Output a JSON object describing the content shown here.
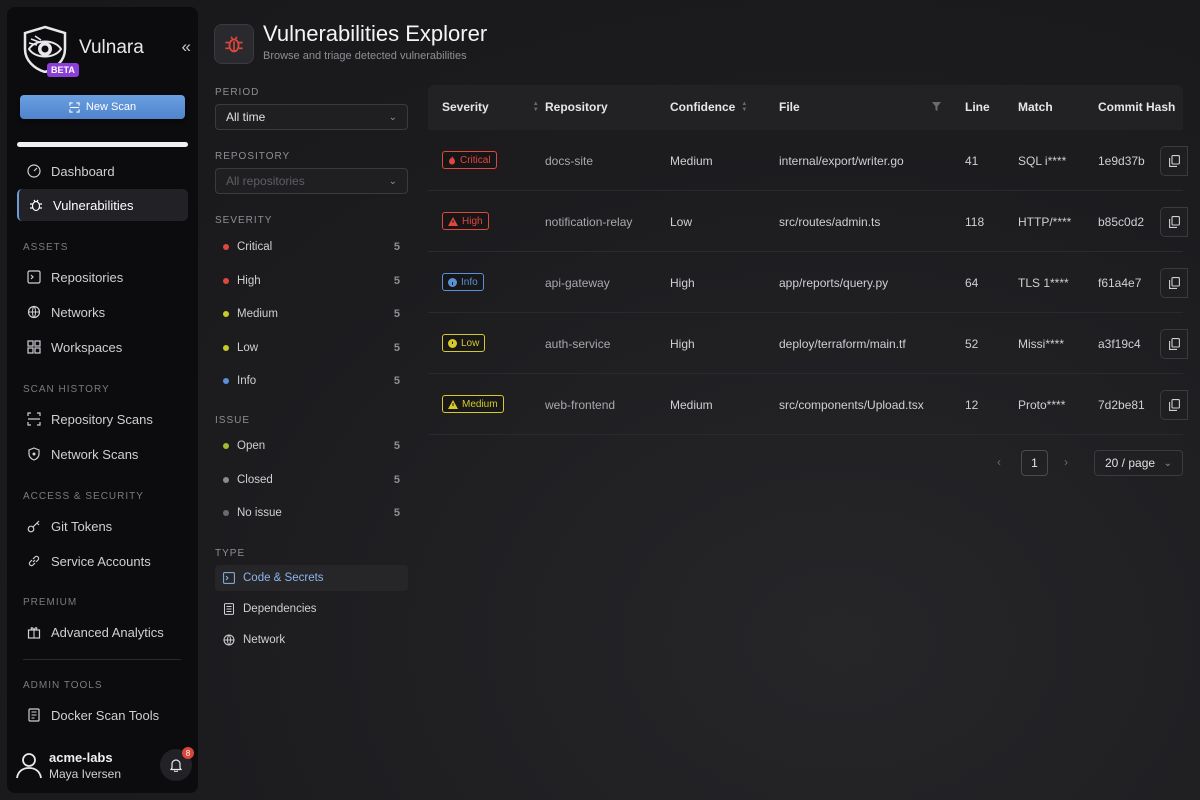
{
  "brand": {
    "name": "Vulnara",
    "badge": "BETA"
  },
  "sidebar": {
    "new_scan": "New Scan",
    "progress": 1.0,
    "items": {
      "dashboard": "Dashboard",
      "vulnerabilities": "Vulnerabilities",
      "repositories": "Repositories",
      "networks": "Networks",
      "workspaces": "Workspaces",
      "repository_scans": "Repository Scans",
      "network_scans": "Network Scans",
      "git_tokens": "Git Tokens",
      "service_accounts": "Service Accounts",
      "advanced_analytics": "Advanced Analytics",
      "docker_scan_tools": "Docker Scan Tools"
    },
    "sections": {
      "assets": "ASSETS",
      "scan_history": "SCAN HISTORY",
      "access_security": "ACCESS & SECURITY",
      "premium": "PREMIUM",
      "admin_tools": "ADMIN TOOLS"
    },
    "user": {
      "org": "acme-labs",
      "name": "Maya Iversen",
      "notifications": "8"
    }
  },
  "header": {
    "title": "Vulnerabilities Explorer",
    "subtitle": "Browse and triage detected vulnerabilities"
  },
  "filters": {
    "period_label": "PERIOD",
    "period_value": "All time",
    "repository_label": "REPOSITORY",
    "repository_placeholder": "All repositories",
    "severity_label": "SEVERITY",
    "severity": [
      {
        "label": "Critical",
        "count": "5",
        "color": "#e0473d"
      },
      {
        "label": "High",
        "count": "5",
        "color": "#e0473d"
      },
      {
        "label": "Medium",
        "count": "5",
        "color": "#c9c92a"
      },
      {
        "label": "Low",
        "count": "5",
        "color": "#c9c92a"
      },
      {
        "label": "Info",
        "count": "5",
        "color": "#5b8fd6"
      }
    ],
    "issue_label": "ISSUE",
    "issue": [
      {
        "label": "Open",
        "count": "5",
        "color": "#a7b82a"
      },
      {
        "label": "Closed",
        "count": "5",
        "color": "#8a8a90"
      },
      {
        "label": "No issue",
        "count": "5",
        "color": "#6a6a70"
      }
    ],
    "type_label": "TYPE",
    "types": [
      {
        "label": "Code & Secrets",
        "icon": "terminal-icon"
      },
      {
        "label": "Dependencies",
        "icon": "list-icon"
      },
      {
        "label": "Network",
        "icon": "globe-icon"
      }
    ]
  },
  "table": {
    "columns": [
      "Severity",
      "Repository",
      "Confidence",
      "File",
      "Line",
      "Match",
      "Commit Hash"
    ],
    "rows": [
      {
        "severity": "Critical",
        "sev_color": "#e0473d",
        "sev_icon": "fire-icon",
        "repository": "docs-site",
        "confidence": "Medium",
        "file": "internal/export/writer.go",
        "line": "41",
        "match": "SQL i****",
        "commit": "1e9d37b"
      },
      {
        "severity": "High",
        "sev_color": "#e0473d",
        "sev_icon": "warning-icon",
        "repository": "notification-relay",
        "confidence": "Low",
        "file": "src/routes/admin.ts",
        "line": "118",
        "match": "HTTP/****",
        "commit": "b85c0d2"
      },
      {
        "severity": "Info",
        "sev_color": "#5b8fd6",
        "sev_icon": "info-icon",
        "repository": "api-gateway",
        "confidence": "High",
        "file": "app/reports/query.py",
        "line": "64",
        "match": "TLS 1****",
        "commit": "f61a4e7"
      },
      {
        "severity": "Low",
        "sev_color": "#d6c92a",
        "sev_icon": "circle-icon",
        "repository": "auth-service",
        "confidence": "High",
        "file": "deploy/terraform/main.tf",
        "line": "52",
        "match": "Missi****",
        "commit": "a3f19c4"
      },
      {
        "severity": "Medium",
        "sev_color": "#d6c92a",
        "sev_icon": "warning-icon",
        "repository": "web-frontend",
        "confidence": "Medium",
        "file": "src/components/Upload.tsx",
        "line": "12",
        "match": "Proto****",
        "commit": "7d2be81"
      }
    ]
  },
  "pagination": {
    "current": "1",
    "per_page": "20 / page"
  }
}
